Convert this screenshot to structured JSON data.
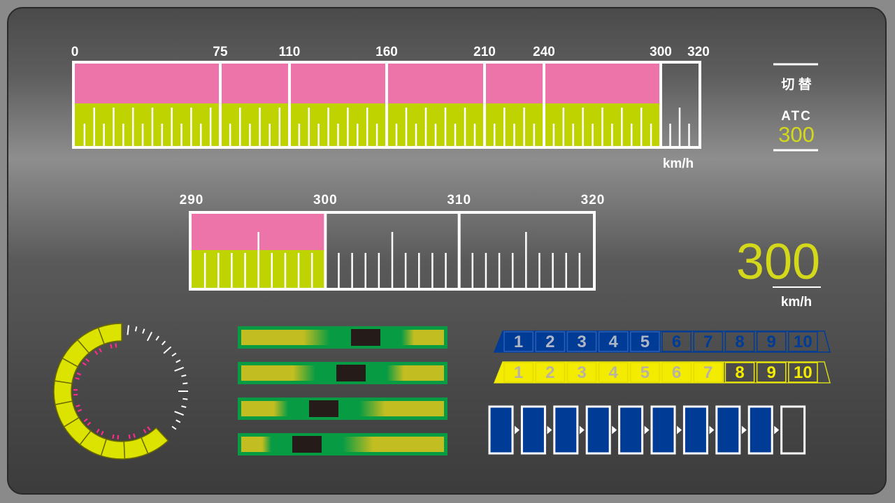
{
  "colors": {
    "pink": "#ec74a8",
    "lime": "#bfd300",
    "white": "#ffffff",
    "yellow": "#d4d81a",
    "ring_yellow": "#dde300",
    "ring_magenta": "#ff2b8a",
    "bar_green": "#079b44",
    "bar_olive": "#c2bd20",
    "block": "#251c1a",
    "blue": "#003c96",
    "blue_dark": "#003378",
    "gray_num": "#8a94a6",
    "gray_num2": "#8d8d8d"
  },
  "top_gauge": {
    "labels": [
      "0",
      "75",
      "110",
      "160",
      "210",
      "240",
      "300",
      "320"
    ],
    "scale_values": [
      0,
      75,
      110,
      160,
      210,
      240,
      300,
      320
    ],
    "min": 0,
    "max": 320,
    "fill_value": 300,
    "unit": "km/h"
  },
  "zoom_gauge": {
    "labels": [
      "290",
      "300",
      "310",
      "320"
    ],
    "min": 290,
    "max": 320,
    "fill_value": 300,
    "scale_step": 10
  },
  "atc": {
    "switch_label": "切 替",
    "mode_label": "ATC",
    "limit_value": "300"
  },
  "speed": {
    "value": "300",
    "unit": "km/h"
  },
  "ring_gauge": {
    "filled_fraction": 0.62
  },
  "notch_bars": [
    {
      "name": "notch-bar-1",
      "position": 0.61
    },
    {
      "name": "notch-bar-2",
      "position": 0.54
    },
    {
      "name": "notch-bar-3",
      "position": 0.41
    },
    {
      "name": "notch-bar-4",
      "position": 0.33
    }
  ],
  "notch_rows": [
    {
      "name": "power-notch-row",
      "numbers": [
        "1",
        "2",
        "3",
        "4",
        "5",
        "6",
        "7",
        "8",
        "9",
        "10"
      ],
      "active_count": 5,
      "style": "blue"
    },
    {
      "name": "brake-notch-row",
      "numbers": [
        "1",
        "2",
        "3",
        "4",
        "5",
        "6",
        "7",
        "8",
        "9",
        "10"
      ],
      "active_count": 7,
      "style": "yellow"
    }
  ],
  "train_cars": {
    "total": 10,
    "filled": 9
  }
}
